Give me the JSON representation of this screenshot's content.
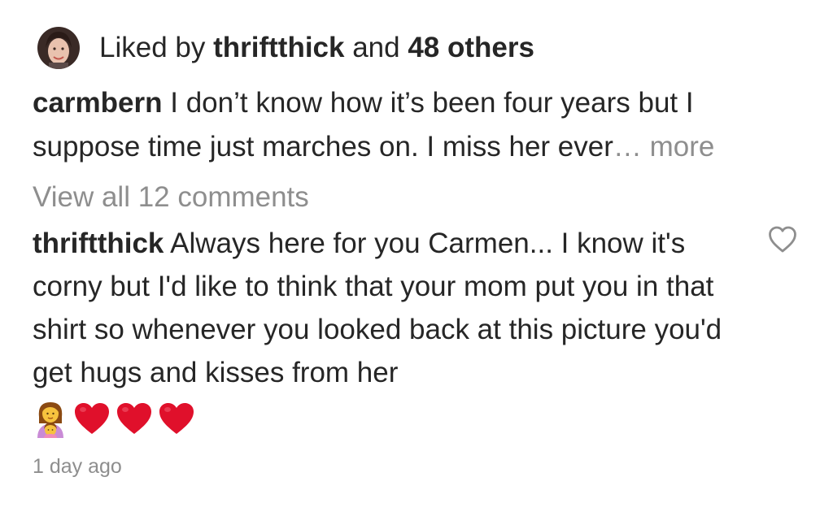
{
  "likes": {
    "prefix": "Liked by ",
    "user": "thriftthick",
    "conjunction": " and ",
    "others": "48 others"
  },
  "caption": {
    "username": "carmbern",
    "text": " I don’t know how it’s been four years but I suppose time just marches on. I miss her ever",
    "more": "… more"
  },
  "view_all": "View all 12 comments",
  "comment": {
    "username": "thriftthick",
    "text": " Always here for you Carmen... I know it's corny but I'd like to think that your mom put you in that shirt so whenever you looked back at this picture you'd get hugs and kisses from her",
    "emojis": [
      "woman-and-girl-emoji",
      "red-heart-emoji",
      "red-heart-emoji",
      "red-heart-emoji"
    ],
    "timestamp": "1 day ago"
  },
  "colors": {
    "text": "#262626",
    "secondary": "#8e8e8e",
    "heart": "#e0102b"
  }
}
